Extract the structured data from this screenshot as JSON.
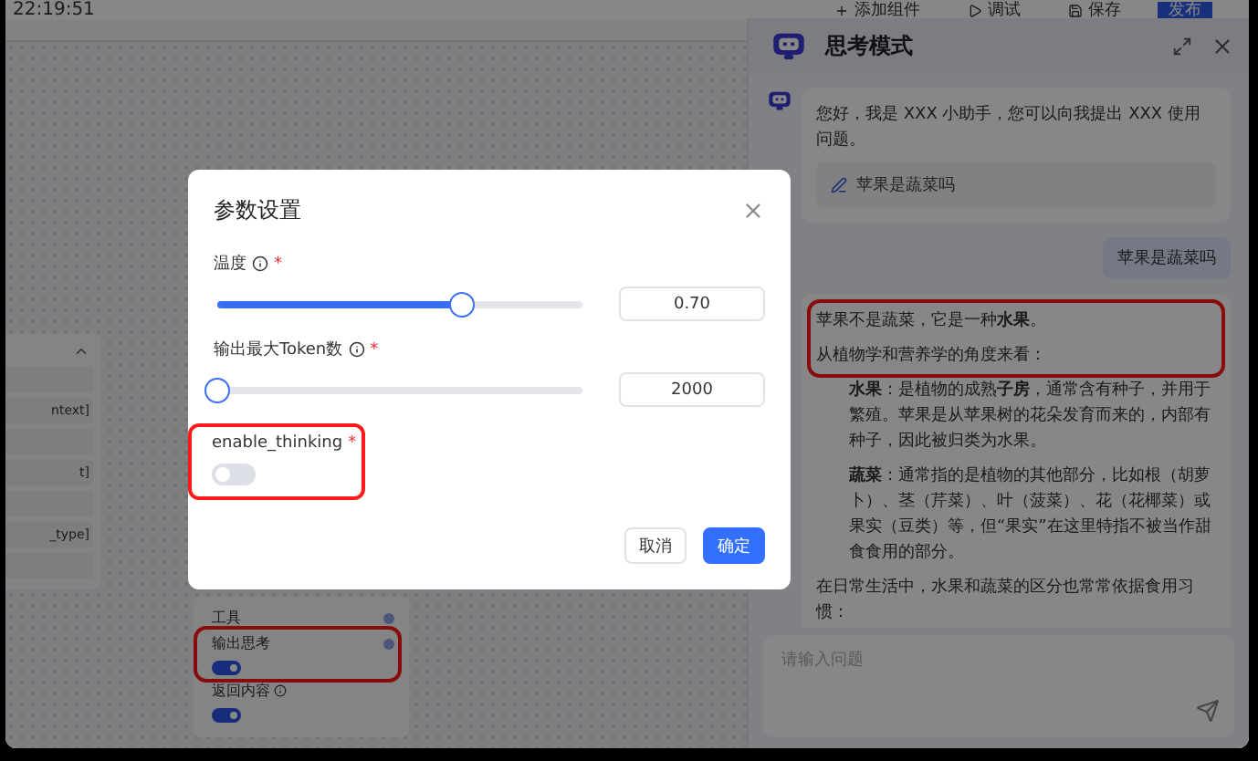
{
  "status_time": "22:19:51",
  "toolbar": {
    "add": "添加组件",
    "debug": "调试",
    "save": "保存",
    "publish": "发布"
  },
  "left_panel": {
    "expanded": true,
    "rows": [
      "ntext]",
      "t]",
      "_type]"
    ]
  },
  "node_panel": {
    "items": [
      {
        "label": "工具",
        "kind": "plain",
        "dot": true,
        "info": false,
        "highlighted": false
      },
      {
        "label": "输出思考",
        "kind": "toggle",
        "on": true,
        "dot": true,
        "info": false,
        "highlighted": true
      },
      {
        "label": "返回内容",
        "kind": "toggle",
        "on": true,
        "dot": false,
        "info": true,
        "highlighted": false
      }
    ]
  },
  "chat": {
    "title": "思考模式",
    "greeting": "您好，我是 XXX 小助手，您可以向我提出 XXX 使用问题。",
    "suggestion": "苹果是蔬菜吗",
    "user_message": "苹果是蔬菜吗",
    "answer": {
      "highlighted": true,
      "lead": "苹果不是蔬菜，它是一种**水果**。",
      "intro": "从植物学和营养学的角度来看：",
      "points": [
        "**水果**：是植物的成熟**子房**，通常含有种子，并用于繁殖。苹果是从苹果树的花朵发育而来的，内部有种子，因此被归类为水果。",
        "**蔬菜**：通常指的是植物的其他部分，比如根（胡萝卜）、茎（芹菜）、叶（菠菜）、花（花椰菜）或果实（豆类）等，但“果实”在这里特指不被当作甜食食用的部分。"
      ],
      "tail": "在日常生活中，水果和蔬菜的区分也常常依据食用习惯："
    },
    "input_placeholder": "请输入问题"
  },
  "dialog": {
    "title": "参数设置",
    "params": [
      {
        "label": "温度",
        "info": true,
        "required_mark": "*",
        "kind": "slider",
        "level": 0.67,
        "value": "0.70",
        "highlighted": false
      },
      {
        "label": "输出最大Token数",
        "info": true,
        "required_mark": "*",
        "kind": "slider",
        "level": 0,
        "value": "2000",
        "highlighted": false
      },
      {
        "label": "enable_thinking",
        "info": false,
        "required_mark": "*",
        "kind": "switch",
        "on": false,
        "highlighted": true
      }
    ],
    "buttons": {
      "cancel": "取消",
      "ok": "确定"
    }
  }
}
